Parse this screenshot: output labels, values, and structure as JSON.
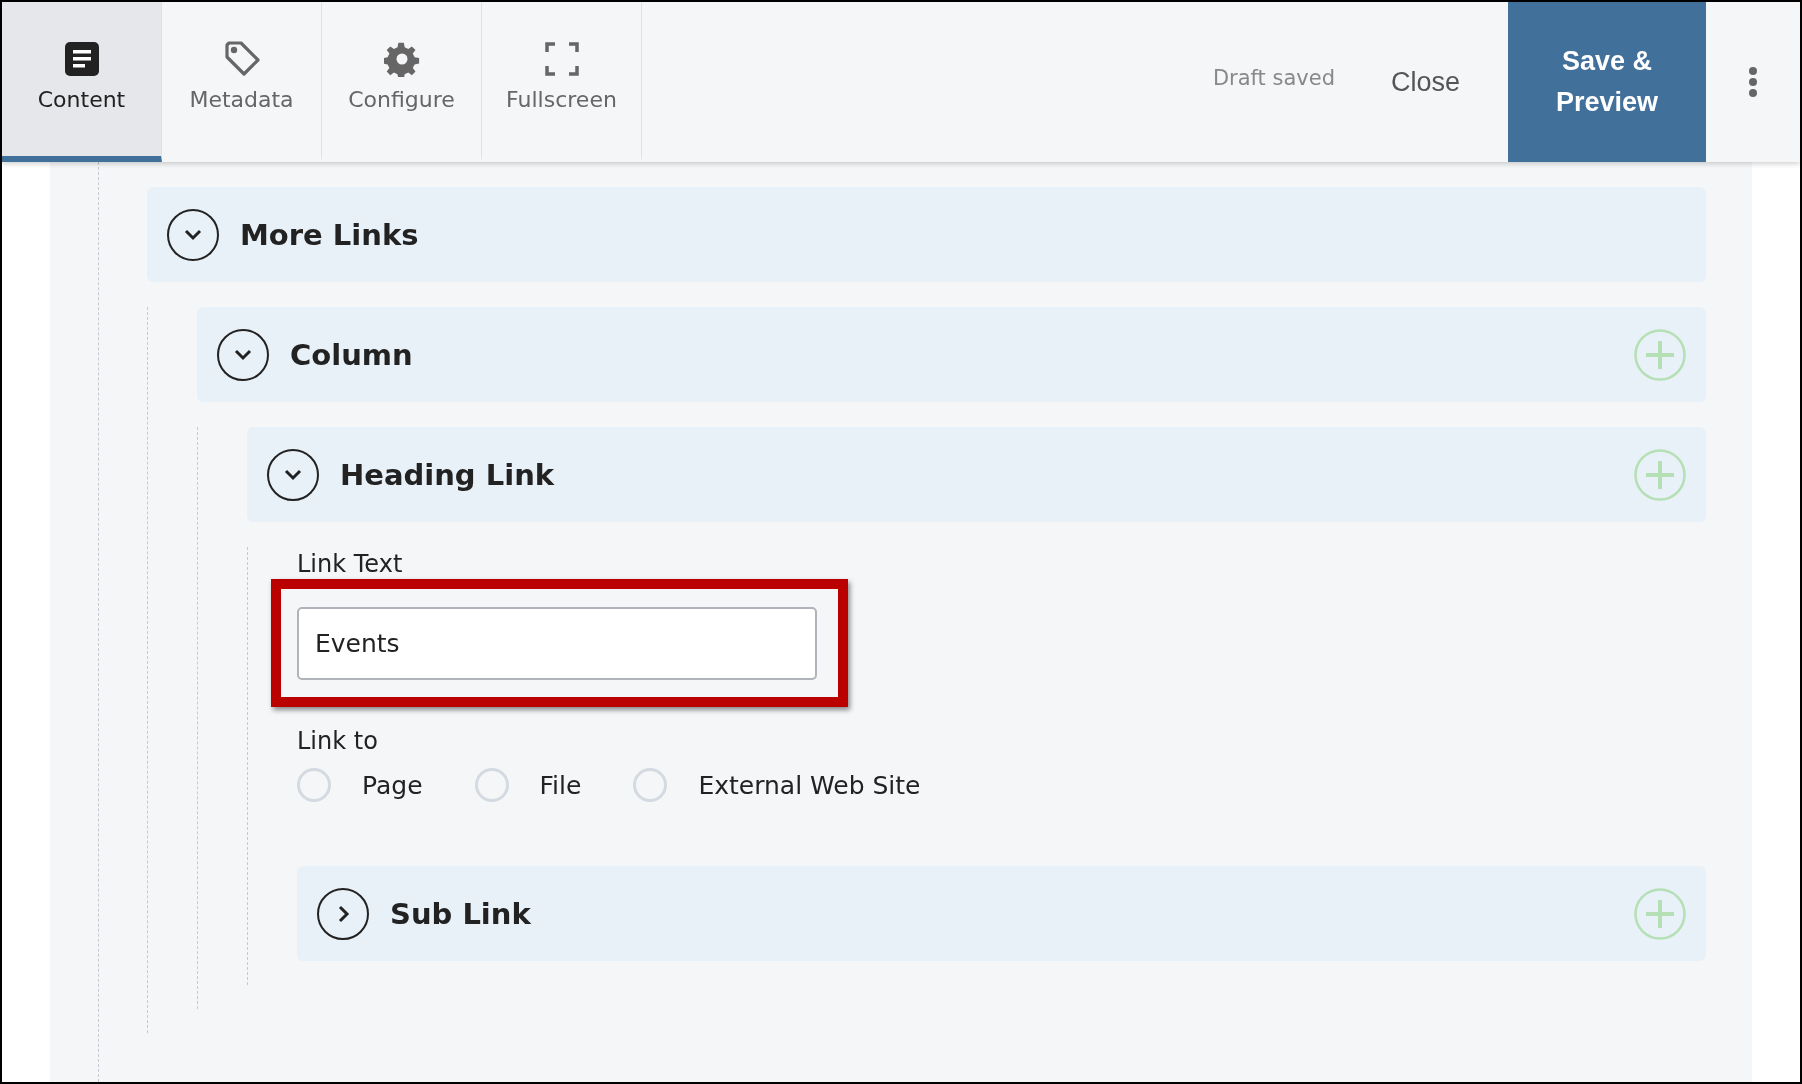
{
  "toolbar": {
    "tabs": [
      {
        "label": "Content",
        "selected": true
      },
      {
        "label": "Metadata",
        "selected": false
      },
      {
        "label": "Configure",
        "selected": false
      },
      {
        "label": "Fullscreen",
        "selected": false
      }
    ],
    "status": "Draft saved",
    "close": "Close",
    "primary": "Save & Preview"
  },
  "sections": [
    {
      "title": "More Links",
      "expanded": true,
      "addable": false,
      "children": [
        {
          "title": "Column",
          "expanded": true,
          "addable": true,
          "children": [
            {
              "title": "Heading Link",
              "expanded": true,
              "addable": true,
              "fields": [
                {
                  "kind": "text",
                  "label": "Link Text",
                  "value": "Events",
                  "highlighted": true
                },
                {
                  "kind": "radio",
                  "label": "Link to",
                  "options": [
                    {
                      "label": "Page",
                      "selected": false
                    },
                    {
                      "label": "File",
                      "selected": false
                    },
                    {
                      "label": "External Web Site",
                      "selected": false
                    }
                  ]
                }
              ],
              "children": [
                {
                  "title": "Sub Link",
                  "expanded": false,
                  "addable": true
                }
              ]
            }
          ]
        }
      ]
    }
  ]
}
